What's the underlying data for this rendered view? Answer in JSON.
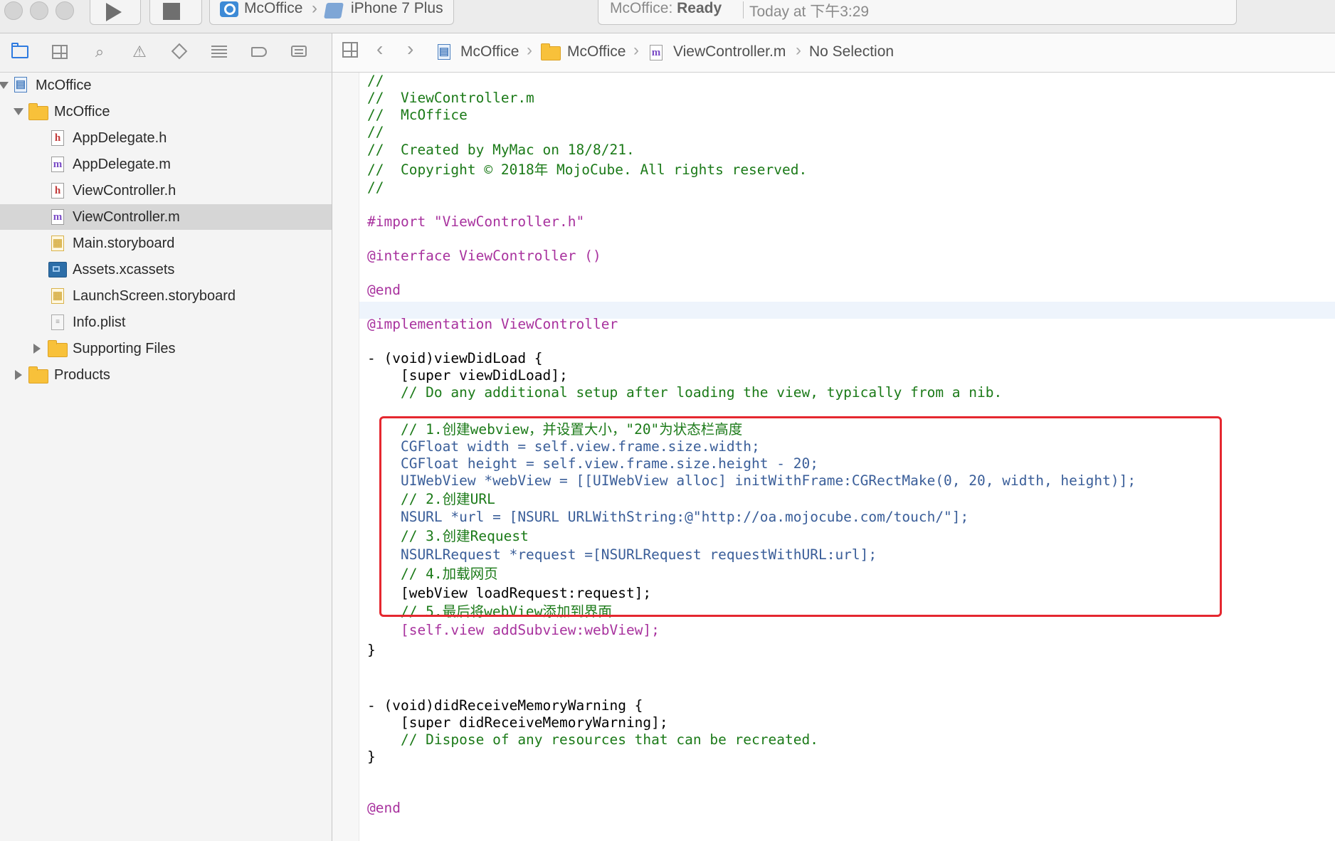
{
  "toolbar": {
    "scheme_app": "McOffice",
    "scheme_device": "iPhone 7 Plus",
    "status_app": "McOffice:",
    "status_state": "Ready",
    "status_time": "Today at 下午3:29"
  },
  "navigator": {
    "items": [
      {
        "label": "McOffice"
      },
      {
        "label": "McOffice"
      },
      {
        "label": "AppDelegate.h"
      },
      {
        "label": "AppDelegate.m"
      },
      {
        "label": "ViewController.h"
      },
      {
        "label": "ViewController.m"
      },
      {
        "label": "Main.storyboard"
      },
      {
        "label": "Assets.xcassets"
      },
      {
        "label": "LaunchScreen.storyboard"
      },
      {
        "label": "Info.plist"
      },
      {
        "label": "Supporting Files"
      },
      {
        "label": "Products"
      }
    ]
  },
  "jumpbar": {
    "crumbs": [
      "McOffice",
      "McOffice",
      "ViewController.m",
      "No Selection"
    ]
  },
  "editor": {
    "lines": [
      "//",
      "//  ViewController.m",
      "//  McOffice",
      "//",
      "//  Created by MyMac on 18/8/21.",
      "//  Copyright © 2018年 MojoCube. All rights reserved.",
      "//",
      "#import \"ViewController.h\"",
      "@interface ViewController ()",
      "@end",
      "@implementation ViewController",
      "- (void)viewDidLoad {",
      "    [super viewDidLoad];",
      "    // Do any additional setup after loading the view, typically from a nib.",
      "    // 1.创建webview，并设置大小，\"20\"为状态栏高度",
      "    CGFloat width = self.view.frame.size.width;",
      "    CGFloat height = self.view.frame.size.height - 20;",
      "    UIWebView *webView = [[UIWebView alloc] initWithFrame:CGRectMake(0, 20, width, height)];",
      "    // 2.创建URL",
      "    NSURL *url = [NSURL URLWithString:@\"http://oa.mojocube.com/touch/\"];",
      "    // 3.创建Request",
      "    NSURLRequest *request =[NSURLRequest requestWithURL:url];",
      "    // 4.加载网页",
      "    [webView loadRequest:request];",
      "    // 5.最后将webView添加到界面",
      "    [self.view addSubview:webView];",
      "}",
      "- (void)didReceiveMemoryWarning {",
      "    [super didReceiveMemoryWarning];",
      "    // Dispose of any resources that can be recreated.",
      "}",
      "@end"
    ]
  }
}
